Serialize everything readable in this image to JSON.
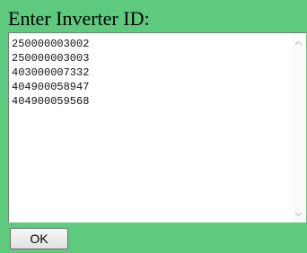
{
  "form": {
    "title": "Enter Inverter ID:",
    "inverter_ids_text": "250000003002\n250000003003\n403000007332\n404900058947\n404900059568",
    "ok_label": "OK"
  },
  "icons": {
    "scroll_up": "chevron-up-icon",
    "scroll_down": "chevron-down-icon"
  },
  "colors": {
    "panel_background": "#5dca7d",
    "textarea_background": "#ffffff"
  }
}
